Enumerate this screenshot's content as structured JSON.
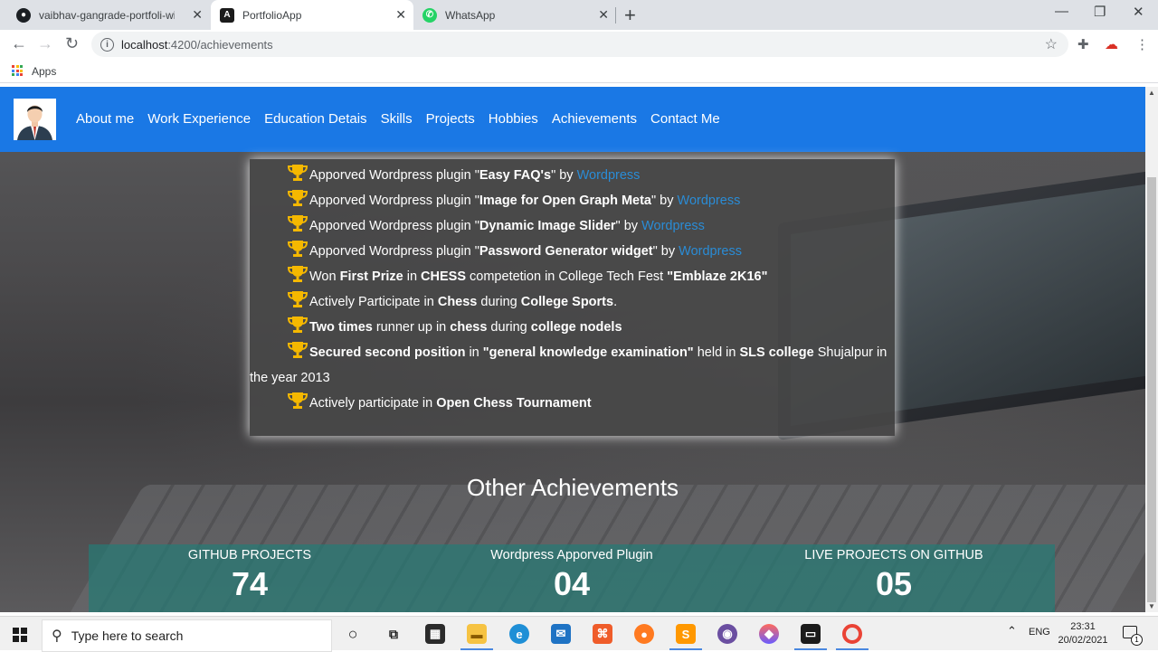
{
  "browser": {
    "tabs": [
      {
        "title": "vaibhav-gangrade-portfoli-with-a",
        "icon": "github-icon"
      },
      {
        "title": "PortfolioApp",
        "icon": "angular-icon"
      },
      {
        "title": "WhatsApp",
        "icon": "whatsapp-icon"
      }
    ],
    "url_host": "localhost",
    "url_path": ":4200/achievements",
    "bookmarks_apps_label": "Apps"
  },
  "nav": {
    "links": [
      "About me",
      "Work Experience",
      "Education Detais",
      "Skills",
      "Projects",
      "Hobbies",
      "Achievements",
      "Contact Me"
    ]
  },
  "achievements": [
    {
      "parts": [
        [
          "t",
          "Apporved Wordpress plugin \""
        ],
        [
          "b",
          "Easy FAQ's"
        ],
        [
          "t",
          "\" by "
        ],
        [
          "l",
          "Wordpress"
        ]
      ]
    },
    {
      "parts": [
        [
          "t",
          "Apporved Wordpress plugin \""
        ],
        [
          "b",
          "Image for Open Graph Meta"
        ],
        [
          "t",
          "\" by "
        ],
        [
          "l",
          "Wordpress"
        ]
      ]
    },
    {
      "parts": [
        [
          "t",
          "Apporved Wordpress plugin \""
        ],
        [
          "b",
          "Dynamic Image Slider"
        ],
        [
          "t",
          "\" by "
        ],
        [
          "l",
          "Wordpress"
        ]
      ]
    },
    {
      "parts": [
        [
          "t",
          "Apporved Wordpress plugin \""
        ],
        [
          "b",
          "Password Generator widget"
        ],
        [
          "t",
          "\" by "
        ],
        [
          "l",
          "Wordpress"
        ]
      ]
    },
    {
      "parts": [
        [
          "t",
          "Won "
        ],
        [
          "b",
          "First Prize"
        ],
        [
          "t",
          " in "
        ],
        [
          "b",
          "CHESS"
        ],
        [
          "t",
          " competetion in College Tech Fest "
        ],
        [
          "b",
          "\"Emblaze 2K16\""
        ]
      ]
    },
    {
      "parts": [
        [
          "t",
          "Actively Participate in "
        ],
        [
          "b",
          "Chess"
        ],
        [
          "t",
          " during "
        ],
        [
          "b",
          "College Sports"
        ],
        [
          "t",
          "."
        ]
      ]
    },
    {
      "parts": [
        [
          "b",
          "Two times"
        ],
        [
          "t",
          " runner up in "
        ],
        [
          "b",
          "chess"
        ],
        [
          "t",
          " during "
        ],
        [
          "b",
          "college nodels"
        ]
      ]
    },
    {
      "parts": [
        [
          "b",
          "Secured second position"
        ],
        [
          "t",
          " in "
        ],
        [
          "b",
          "\"general knowledge examination\""
        ],
        [
          "t",
          " held in "
        ],
        [
          "b",
          "SLS college"
        ],
        [
          "t",
          " Shujalpur in the year 2013"
        ]
      ]
    },
    {
      "parts": [
        [
          "t",
          "Actively participate in "
        ],
        [
          "b",
          "Open Chess Tournament"
        ]
      ]
    }
  ],
  "other_achievements": {
    "title": "Other Achievements",
    "stats": [
      {
        "label": "GITHUB PROJECTS",
        "value": "74"
      },
      {
        "label": "Wordpress Apporved Plugin",
        "value": "04"
      },
      {
        "label": "LIVE PROJECTS ON GITHUB",
        "value": "05"
      }
    ]
  },
  "taskbar": {
    "search_placeholder": "Type here to search",
    "language": "ENG",
    "time": "23:31",
    "date": "20/02/2021",
    "notification_count": "1"
  },
  "colors": {
    "navbar": "#1a78e5",
    "link": "#2a8cd6",
    "trophy": "#f5b800",
    "stats_band": "#267a75"
  }
}
